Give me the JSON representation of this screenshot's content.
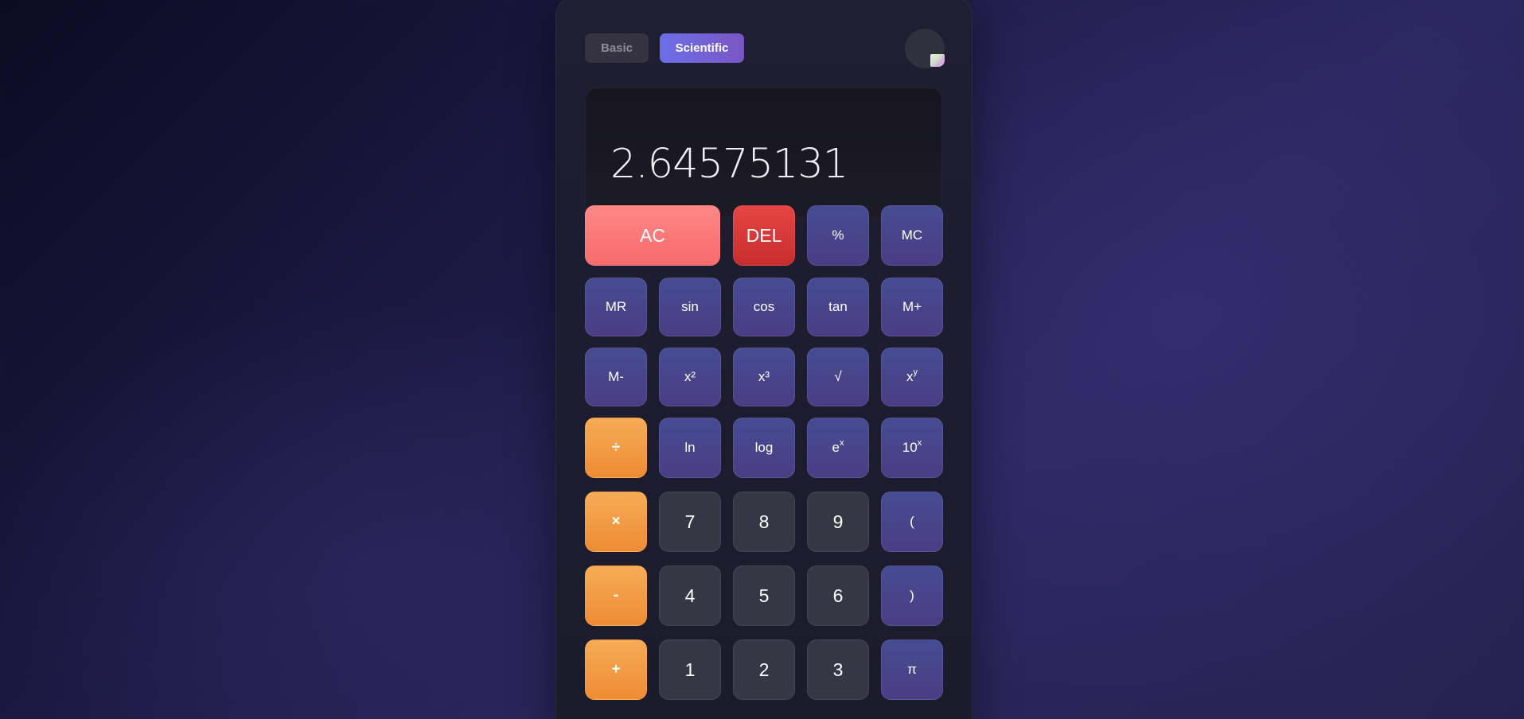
{
  "modes": {
    "basic": "Basic",
    "scientific": "Scientific",
    "active": "Scientific"
  },
  "display": {
    "value": "2.64575131"
  },
  "keys": {
    "ac": "AC",
    "del": "DEL",
    "percent": "%",
    "mc": "MC",
    "mr": "MR",
    "sin": "sin",
    "cos": "cos",
    "tan": "tan",
    "mplus": "M+",
    "mminus": "M-",
    "square": "x²",
    "cube": "x³",
    "sqrt": "√",
    "pow_base": "x",
    "pow_exp": "y",
    "divide": "÷",
    "ln": "ln",
    "log": "log",
    "exp_base": "e",
    "exp_exp": "x",
    "ten_base": "10",
    "ten_exp": "x",
    "multiply": "×",
    "seven": "7",
    "eight": "8",
    "nine": "9",
    "lparen": "(",
    "minus": "-",
    "four": "4",
    "five": "5",
    "six": "6",
    "rparen": ")",
    "plus": "+",
    "one": "1",
    "two": "2",
    "three": "3",
    "pi": "π"
  },
  "icons": {
    "theme_toggle": "theme-icon"
  },
  "colors": {
    "accent": "#6c6fe8",
    "operator": "#f39a40",
    "clear": "#ff7b7b",
    "delete": "#d83a3a",
    "function_key": "#474787",
    "number_key": "#363744"
  }
}
